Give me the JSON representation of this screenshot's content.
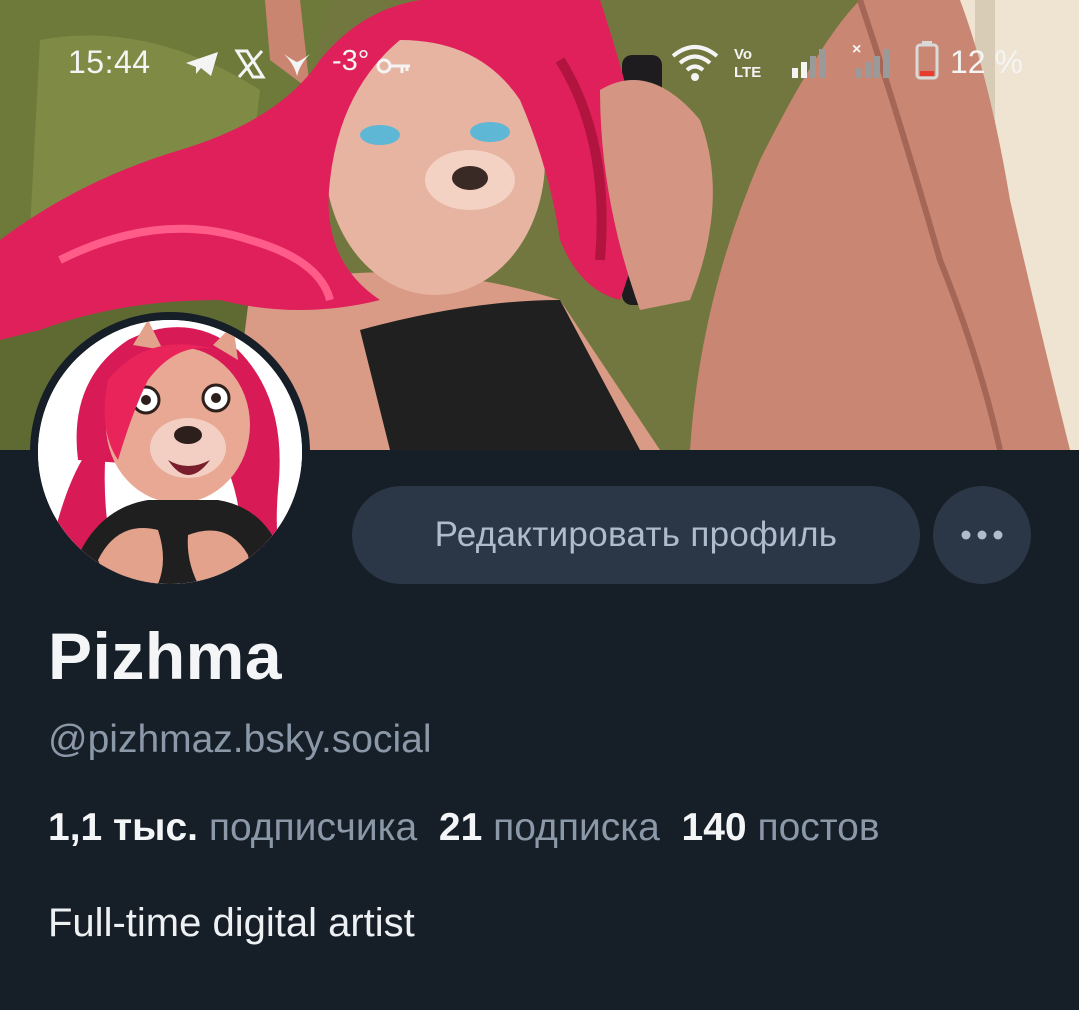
{
  "status_bar": {
    "time": "15:44",
    "temperature": "-3°",
    "battery_percent": "12 %",
    "icons": [
      "telegram-icon",
      "x-icon",
      "bird-icon",
      "key-icon",
      "wifi-icon",
      "volte-icon",
      "signal-icon",
      "signal-no-service-icon",
      "battery-low-icon"
    ]
  },
  "profile": {
    "display_name": "Pizhma",
    "handle": "@pizhmaz.bsky.social",
    "edit_button_label": "Редактировать профиль",
    "more_button_icon": "more-dots-icon",
    "bio": "Full-time digital artist",
    "stats": {
      "followers_count": "1,1 тыс.",
      "followers_label": "подписчика",
      "following_count": "21",
      "following_label": "подписка",
      "posts_count": "140",
      "posts_label": "постов"
    }
  },
  "colors": {
    "background": "#161e27",
    "button_bg": "#2b3646",
    "button_text": "#aebccc",
    "primary_text": "#f3f5f7",
    "secondary_text": "#8a98a8",
    "hair_accent": "#e8245a"
  }
}
